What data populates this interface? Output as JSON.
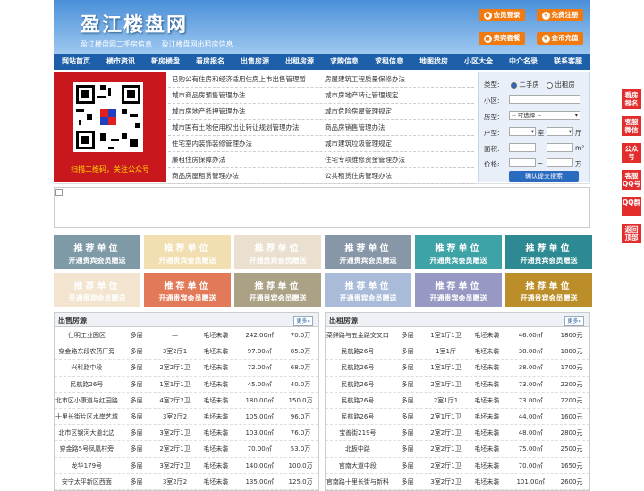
{
  "header": {
    "logo": "盈江楼盘网",
    "sublinks": [
      "盈江楼盘网二手房信息",
      "盈江楼盘网出租房信息"
    ],
    "buttons": [
      {
        "icon": "user-icon",
        "label": "会员登录"
      },
      {
        "icon": "plus-icon",
        "label": "免费注册"
      },
      {
        "icon": "package-icon",
        "label": "贵宾套餐"
      },
      {
        "icon": "coin-icon",
        "label": "金币充值"
      }
    ]
  },
  "nav": [
    "网站首页",
    "楼市资讯",
    "新房楼盘",
    "看房报名",
    "出售房源",
    "出租房源",
    "求购信息",
    "求租信息",
    "地图找房",
    "小区大全",
    "中介名录",
    "联系客服"
  ],
  "qr": {
    "caption": "扫描二维码，关注公众号"
  },
  "links": [
    [
      "已购公有住房和经济适用住房上市出售管理暂",
      "房屋建筑工程质量保修办法"
    ],
    [
      "城市商品房预售管理办法",
      "城市房地产转让管理规定"
    ],
    [
      "城市房地产抵押管理办法",
      "城市危险房屋管理规定"
    ],
    [
      "城市国有土地使用权出让转让规划管理办法",
      "商品房销售管理办法"
    ],
    [
      "住宅室内装饰装修管理办法",
      "城市建筑垃圾管理规定"
    ],
    [
      "廉租住房保障办法",
      "住宅专项维修资金管理办法"
    ],
    [
      "商品房屋租赁管理办法",
      "公共租赁住房管理办法"
    ]
  ],
  "search": {
    "type_label": "类型:",
    "type_options": [
      "二手房",
      "出租房"
    ],
    "community_label": "小区:",
    "housetype_label": "房型:",
    "housetype_value": "-- 可选择 --",
    "layout_label": "户型:",
    "room_unit": "室",
    "hall_unit": "厅",
    "area_label": "面积:",
    "area_unit": "m²",
    "price_label": "价格:",
    "price_unit": "万",
    "tilde": "~",
    "submit": "确认提交搜索"
  },
  "ads": [
    {
      "t1": "推荐单位",
      "t2": "开通贵宾会员赠送",
      "color": "#7d9aa6"
    },
    {
      "t1": "推荐单位",
      "t2": "开通贵宾会员赠送",
      "color": "#f1dfb1"
    },
    {
      "t1": "推荐单位",
      "t2": "开通贵宾会员赠送",
      "color": "#ebe0cf"
    },
    {
      "t1": "推荐单位",
      "t2": "开通贵宾会员赠送",
      "color": "#8797a8"
    },
    {
      "t1": "推荐单位",
      "t2": "开通贵宾会员赠送",
      "color": "#3ea3a7"
    },
    {
      "t1": "推荐单位",
      "t2": "开通贵宾会员赠送",
      "color": "#2d8a92"
    },
    {
      "t1": "推荐单位",
      "t2": "开通贵宾会员赠送",
      "color": "#f2e4cf"
    },
    {
      "t1": "推荐单位",
      "t2": "开通贵宾会员赠送",
      "color": "#e27a5a"
    },
    {
      "t1": "推荐单位",
      "t2": "开通贵宾会员赠送",
      "color": "#aba286"
    },
    {
      "t1": "推荐单位",
      "t2": "开通贵宾会员赠送",
      "color": "#a9bbd9"
    },
    {
      "t1": "推荐单位",
      "t2": "开通贵宾会员赠送",
      "color": "#9898c4"
    },
    {
      "t1": "推荐单位",
      "t2": "开通贵宾会员赠送",
      "color": "#bb8e29"
    }
  ],
  "sale": {
    "title": "出售房源",
    "more": "更多»",
    "rows": [
      [
        "仕明工业园区",
        "多层",
        "—",
        "毛坯未装",
        "242.00㎡",
        "70.0万"
      ],
      [
        "穿金路东段农药厂旁",
        "多层",
        "3室2厅1",
        "毛坯未装",
        "97.00㎡",
        "85.0万"
      ],
      [
        "兴科路中段",
        "多层",
        "2室2厅1卫",
        "毛坯未装",
        "72.00㎡",
        "68.0万"
      ],
      [
        "民航路26号",
        "多层",
        "1室1厅1卫",
        "毛坯未装",
        "45.00㎡",
        "40.0万"
      ],
      [
        "北市区小康道与红园路",
        "多层",
        "4室2厅2卫",
        "毛坯未装",
        "180.00㎡",
        "150.0万"
      ],
      [
        "十里长街片区水岸艺城",
        "多层",
        "3室2厅2",
        "毛坯未装",
        "105.00㎡",
        "96.0万"
      ],
      [
        "北市区银河大道北边",
        "多层",
        "3室2厅1卫",
        "毛坯未装",
        "103.00㎡",
        "76.0万"
      ],
      [
        "穿金路5号凤凰村旁",
        "多层",
        "2室2厅1卫",
        "毛坯未装",
        "70.00㎡",
        "53.0万"
      ],
      [
        "龙华179号",
        "多层",
        "3室2厅2卫",
        "毛坯未装",
        "140.00㎡",
        "100.0万"
      ],
      [
        "安宁太平新区西面",
        "多层",
        "3室2厅2",
        "毛坯未装",
        "135.00㎡",
        "125.0万"
      ]
    ]
  },
  "rent": {
    "title": "出租房源",
    "more": "更多»",
    "rows": [
      [
        "菜鲜路与五金路交叉口",
        "多层",
        "1室1厅1卫",
        "毛坯未装",
        "46.00㎡",
        "1800元"
      ],
      [
        "民航路26号",
        "多层",
        "1室1厅",
        "毛坯未装",
        "38.00㎡",
        "1800元"
      ],
      [
        "民航路26号",
        "多层",
        "1室1厅1卫",
        "毛坯未装",
        "38.00㎡",
        "1700元"
      ],
      [
        "民航路26号",
        "多层",
        "2室1厅1卫",
        "毛坯未装",
        "73.00㎡",
        "2200元"
      ],
      [
        "民航路26号",
        "多层",
        "2室1厅1",
        "毛坯未装",
        "73.00㎡",
        "2200元"
      ],
      [
        "民航路26号",
        "多层",
        "2室1厅1卫",
        "毛坯未装",
        "44.00㎡",
        "1600元"
      ],
      [
        "宝善街219号",
        "多层",
        "2室2厅1卫",
        "毛坯未装",
        "48.00㎡",
        "2800元"
      ],
      [
        "北板中路",
        "多层",
        "2室2厅1卫",
        "毛坯未装",
        "75.00㎡",
        "2500元"
      ],
      [
        "官南大道中段",
        "多层",
        "2室2厅1卫",
        "毛坯未装",
        "70.00㎡",
        "1650元"
      ],
      [
        "官南路十里长街与新科",
        "多层",
        "3室2厅2卫",
        "毛坯未装",
        "101.00㎡",
        "2600元"
      ]
    ]
  },
  "sidebar": [
    "看房报名",
    "客服微信",
    "公众号",
    "客服QQ号",
    "QQ群",
    "返回顶部"
  ]
}
